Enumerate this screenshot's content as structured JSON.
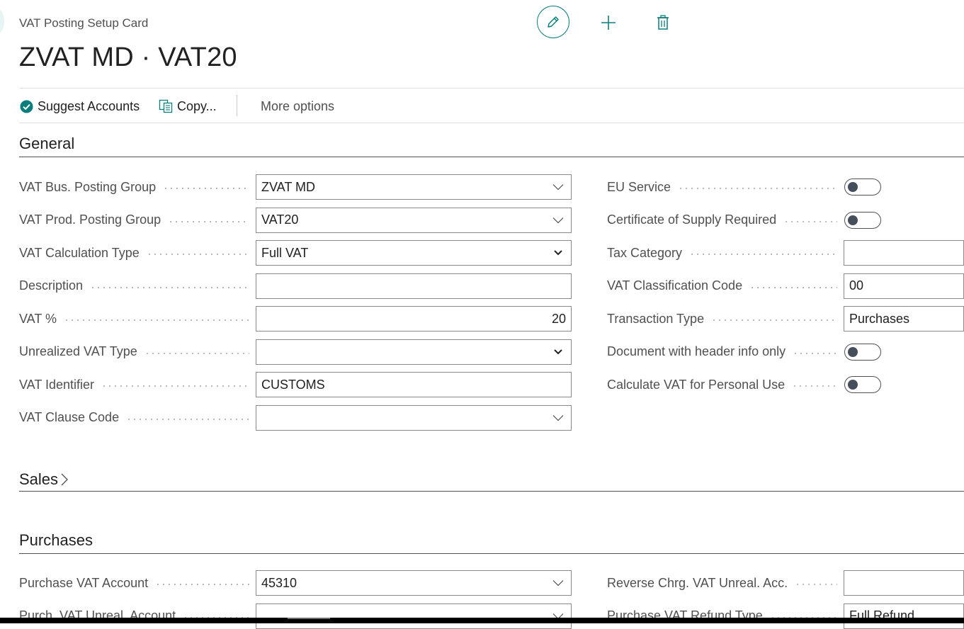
{
  "page": {
    "caption": "VAT Posting Setup Card",
    "title": "ZVAT MD · VAT20"
  },
  "header_icons": {
    "edit": "pencil-icon",
    "new": "plus-icon",
    "delete": "trash-icon",
    "accent": "#0a7d7d"
  },
  "actions": {
    "suggest_accounts": "Suggest Accounts",
    "copy": "Copy...",
    "more_options": "More options"
  },
  "sections": {
    "general": "General",
    "sales": "Sales",
    "purchases": "Purchases"
  },
  "general_left": [
    {
      "label": "VAT Bus. Posting Group",
      "value": "ZVAT MD",
      "kind": "lookup"
    },
    {
      "label": "VAT Prod. Posting Group",
      "value": "VAT20",
      "kind": "lookup"
    },
    {
      "label": "VAT Calculation Type",
      "value": "Full VAT",
      "kind": "select"
    },
    {
      "label": "Description",
      "value": "",
      "kind": "text"
    },
    {
      "label": "VAT %",
      "value": "20",
      "kind": "number"
    },
    {
      "label": "Unrealized VAT Type",
      "value": "",
      "kind": "select"
    },
    {
      "label": "VAT Identifier",
      "value": "CUSTOMS",
      "kind": "text"
    },
    {
      "label": "VAT Clause Code",
      "value": "",
      "kind": "lookup"
    }
  ],
  "general_right": [
    {
      "label": "EU Service",
      "kind": "toggle",
      "on": false
    },
    {
      "label": "Certificate of Supply Required",
      "kind": "toggle",
      "on": false
    },
    {
      "label": "Tax Category",
      "value": "",
      "kind": "text"
    },
    {
      "label": "VAT Classification Code",
      "value": "00",
      "kind": "text"
    },
    {
      "label": "Transaction Type",
      "value": "Purchases",
      "kind": "text"
    },
    {
      "label": "Document with header info only",
      "kind": "toggle",
      "on": false
    },
    {
      "label": "Calculate VAT for Personal Use",
      "kind": "toggle",
      "on": false
    }
  ],
  "purchases_left": [
    {
      "label": "Purchase VAT Account",
      "value": "45310",
      "kind": "lookup"
    },
    {
      "label": "Purch. VAT Unreal. Account",
      "value": "",
      "kind": "lookup"
    }
  ],
  "purchases_right": [
    {
      "label": "Reverse Chrg. VAT Unreal. Acc.",
      "value": "",
      "kind": "text"
    },
    {
      "label": "Purchase VAT Refund Type",
      "value": "Full Refund",
      "kind": "text"
    }
  ]
}
